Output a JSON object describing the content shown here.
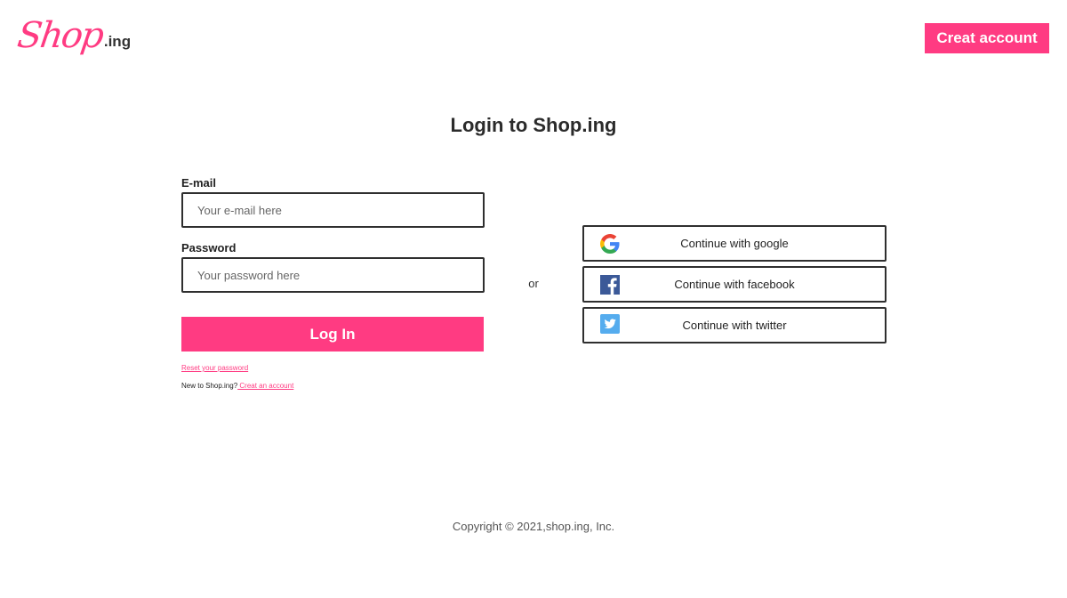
{
  "header": {
    "logo_script": "Shop",
    "logo_suffix": ".ing",
    "create_account_label": "Creat account"
  },
  "title": "Login to Shop.ing",
  "form": {
    "email_label": "E-mail",
    "email_placeholder": "Your e-mail here",
    "email_value": "",
    "password_label": "Password",
    "password_placeholder": "Your password here",
    "password_value": "",
    "login_label": "Log In",
    "reset_link": "Reset your password",
    "new_user_prefix": "New to Shop.ing?",
    "new_user_link": " Creat an account"
  },
  "separator": "or",
  "social": [
    {
      "label": "Continue with google",
      "icon": "google-icon"
    },
    {
      "label": "Continue with facebook",
      "icon": "facebook-icon"
    },
    {
      "label": "Continue with twitter",
      "icon": "twitter-icon"
    }
  ],
  "footer": {
    "copyright": "Copyright © 2021,shop.ing, Inc."
  },
  "colors": {
    "accent": "#ff3b82",
    "text": "#222222",
    "border": "#2f2f2f"
  }
}
